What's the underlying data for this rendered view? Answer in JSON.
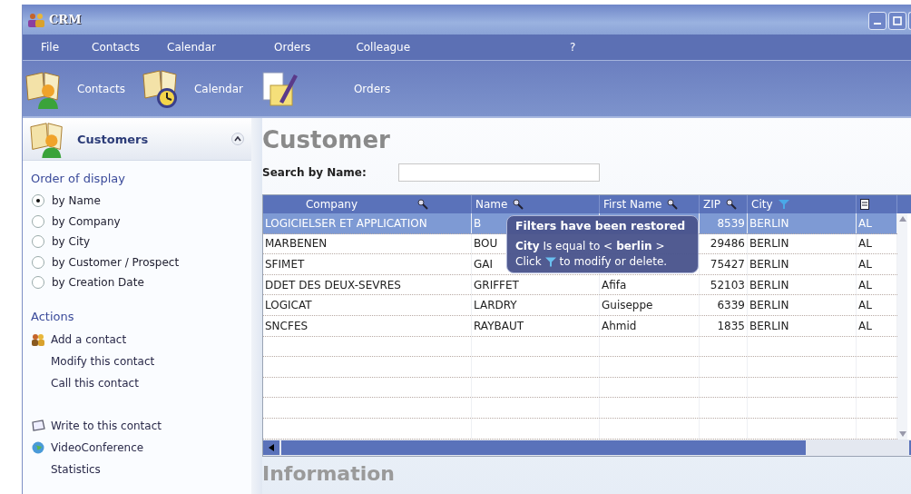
{
  "window": {
    "title": "CRM"
  },
  "menu": [
    "File",
    "Contacts",
    "Calendar",
    "Orders",
    "Colleague",
    "?"
  ],
  "toolbar": [
    {
      "label": "Contacts",
      "kind": "contacts"
    },
    {
      "label": "Calendar",
      "kind": "calendar"
    },
    {
      "label": "Orders",
      "kind": "orders"
    }
  ],
  "sidebar": {
    "title": "Customers",
    "order_heading": "Order of display",
    "options": [
      {
        "label": "by Name",
        "selected": true
      },
      {
        "label": "by Company",
        "selected": false
      },
      {
        "label": "by City",
        "selected": false
      },
      {
        "label": "by Customer / Prospect",
        "selected": false
      },
      {
        "label": "by Creation Date",
        "selected": false
      }
    ],
    "actions_heading": "Actions",
    "action_groups": [
      [
        {
          "label": "Add a contact",
          "kind": "people"
        },
        {
          "label": "Modify this contact",
          "kind": "plain"
        },
        {
          "label": "Call this contact",
          "kind": "plain"
        }
      ],
      [
        {
          "label": "Write to this contact",
          "kind": "write"
        },
        {
          "label": "VideoConference",
          "kind": "globe"
        },
        {
          "label": "Statistics",
          "kind": "plain"
        }
      ]
    ]
  },
  "main": {
    "title": "Customer",
    "search": {
      "label": "Search by Name:"
    },
    "table": {
      "columns": [
        {
          "label": "Company"
        },
        {
          "label": "Name"
        },
        {
          "label": "First Name"
        },
        {
          "label": "ZIP"
        },
        {
          "label": "City"
        },
        {}
      ],
      "rows": [
        {
          "selected": true,
          "cells": [
            "LOGICIELSER ET APPLICATION",
            "B",
            "",
            "8539",
            "BERLIN",
            "AL"
          ]
        },
        {
          "selected": false,
          "cells": [
            "MARBENEN",
            "BOU",
            "",
            "29486",
            "BERLIN",
            "AL"
          ]
        },
        {
          "selected": false,
          "cells": [
            "SFIMET",
            "GAI",
            "",
            "75427",
            "BERLIN",
            "AL"
          ]
        },
        {
          "selected": false,
          "cells": [
            "DDET DES DEUX-SEVRES",
            "GRIFFET",
            "Afifa",
            "52103",
            "BERLIN",
            "AL"
          ]
        },
        {
          "selected": false,
          "cells": [
            "LOGICAT",
            "LARDRY",
            "Guiseppe",
            "6339",
            "BERLIN",
            "AL"
          ]
        },
        {
          "selected": false,
          "cells": [
            "SNCFES",
            "RAYBAUT",
            "Ahmid",
            "1835",
            "BERLIN",
            "AL"
          ]
        }
      ]
    },
    "tooltip": {
      "title": "Filters have been restored",
      "condition": "**City** Is equal to <**berlin**>",
      "hint_before": "Click",
      "hint_after": "to modify or delete."
    },
    "info_heading": "Information"
  }
}
